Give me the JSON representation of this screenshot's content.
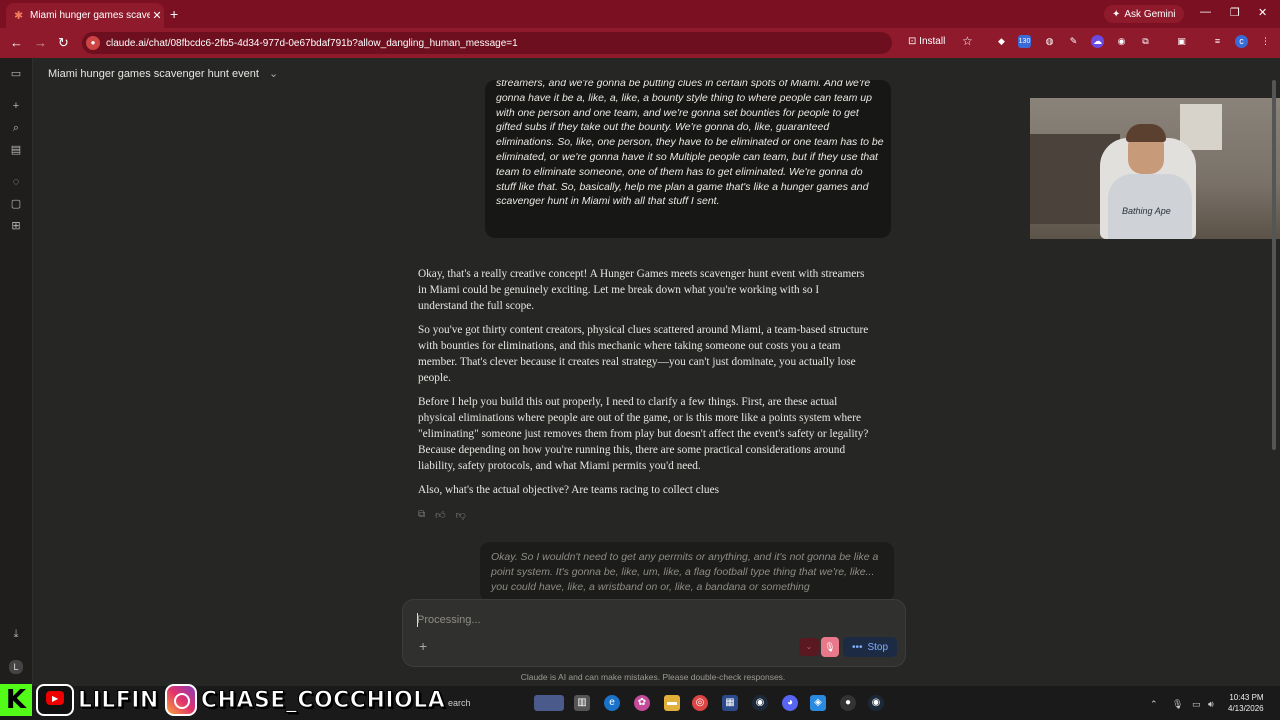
{
  "browser": {
    "tab_title": "Miami hunger games scave",
    "tab_close": "✕",
    "new_tab": "+",
    "ask_gemini": "Ask Gemini",
    "url": "claude.ai/chat/08fbcdc6-2fb5-4d34-977d-0e67bdaf791b?allow_dangling_human_message=1",
    "install_label": "Install",
    "ext_badge": "130"
  },
  "conversation": {
    "title": "Miami hunger games scavenger hunt event"
  },
  "messages": {
    "user_1": "streamers, and we're gonna be putting clues in certain spots of Miami. And we're gonna have it be a, like, a, like, a bounty style thing to where people can team up with one person and one team, and we're gonna set bounties for people to get gifted subs if they take out the bounty. We're gonna do, like, guaranteed eliminations. So, like, one person, they have to be eliminated or one team has to be eliminated, or we're gonna have it so Multiple people can team, but if they use that team to eliminate someone, one of them has to get eliminated. We're gonna do stuff like that. So, basically, help me plan a game that's like a hunger games and scavenger hunt in Miami with all that stuff I sent.",
    "assistant_p1": "Okay, that's a really creative concept! A Hunger Games meets scavenger hunt event with streamers in Miami could be genuinely exciting. Let me break down what you're working with so I understand the full scope.",
    "assistant_p2": "So you've got thirty content creators, physical clues scattered around Miami, a team-based structure with bounties for eliminations, and this mechanic where taking someone out costs you a team member. That's clever because it creates real strategy—you can't just dominate, you actually lose people.",
    "assistant_p3": "Before I help you build this out properly, I need to clarify a few things. First, are these actual physical eliminations where people are out of the game, or is this more like a points system where \"eliminating\" someone just removes them from play but doesn't affect the event's safety or legality? Because depending on how you're running this, there are some practical considerations around liability, safety protocols, and what Miami permits you'd need.",
    "assistant_p4": "Also, what's the actual objective? Are teams racing to collect clues",
    "user_2": "Okay. So I wouldn't need to get any permits or anything, and it's not gonna be like a point system. It's gonna be, like, um, like, a flag football type thing that we're, like... you could have, like, a wristband on or, like, a bandana or something"
  },
  "composer": {
    "placeholder": "Processing...",
    "stop_label": "Stop",
    "disclaimer": "Claude is AI and can make mistakes. Please double-check responses."
  },
  "webcam": {
    "shirt_text": "Bathing Ape"
  },
  "overlay": {
    "handle_1": "LILFIN",
    "handle_2": "CHASE_COCCHIOLA"
  },
  "taskbar": {
    "search": "earch",
    "time": "10:43 PM",
    "date": "4/13/2026"
  },
  "sidebar": {
    "avatar_letter": "L"
  },
  "colors": {
    "accent_red": "#7a1022",
    "stop_blue": "#7eb0ff",
    "bg": "#262624"
  }
}
